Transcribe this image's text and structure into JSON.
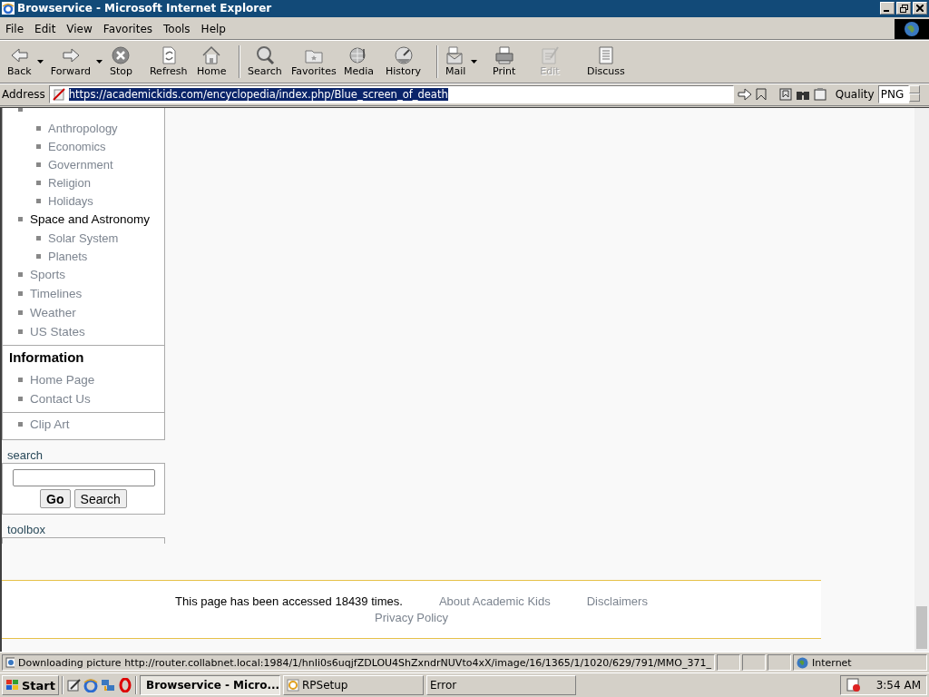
{
  "window": {
    "title": "Browservice - Microsoft Internet Explorer"
  },
  "menu": [
    "File",
    "Edit",
    "View",
    "Favorites",
    "Tools",
    "Help"
  ],
  "toolbar": [
    {
      "label": "Back",
      "kind": "back",
      "disabled": false,
      "dropdown": true
    },
    {
      "label": "Forward",
      "kind": "forward",
      "disabled": false,
      "dropdown": true
    },
    {
      "label": "Stop",
      "kind": "stop",
      "disabled": false,
      "dropdown": false
    },
    {
      "label": "Refresh",
      "kind": "refresh",
      "disabled": false,
      "dropdown": false
    },
    {
      "label": "Home",
      "kind": "home",
      "disabled": false,
      "dropdown": false
    },
    {
      "label": "Search",
      "kind": "search",
      "disabled": false,
      "dropdown": false
    },
    {
      "label": "Favorites",
      "kind": "favorites",
      "disabled": false,
      "dropdown": false
    },
    {
      "label": "Media",
      "kind": "media",
      "disabled": false,
      "dropdown": false
    },
    {
      "label": "History",
      "kind": "history",
      "disabled": false,
      "dropdown": false
    },
    {
      "label": "Mail",
      "kind": "mail",
      "disabled": false,
      "dropdown": true
    },
    {
      "label": "Print",
      "kind": "print",
      "disabled": false,
      "dropdown": false
    },
    {
      "label": "Edit",
      "kind": "edit",
      "disabled": true,
      "dropdown": false
    },
    {
      "label": "Discuss",
      "kind": "discuss",
      "disabled": false,
      "dropdown": false
    }
  ],
  "address": {
    "label": "Address",
    "value": "https://academickids.com/encyclopedia/index.php/Blue_screen_of_death",
    "quality_label": "Quality",
    "quality": "PNG"
  },
  "sidebar": {
    "nav": [
      {
        "children": [
          {
            "label": "Anthropology",
            "active": false
          },
          {
            "label": "Economics",
            "active": false
          },
          {
            "label": "Government",
            "active": false
          },
          {
            "label": "Religion",
            "active": false
          },
          {
            "label": "Holidays",
            "active": false
          }
        ]
      },
      {
        "label": "Space and Astronomy",
        "active": true,
        "children": [
          {
            "label": "Solar System",
            "active": false
          },
          {
            "label": "Planets",
            "active": false
          }
        ]
      },
      {
        "label": "Sports",
        "active": false
      },
      {
        "label": "Timelines",
        "active": false
      },
      {
        "label": "Weather",
        "active": false
      },
      {
        "label": "US States",
        "active": false
      }
    ],
    "information": {
      "heading": "Information",
      "items": [
        "Home Page",
        "Contact Us"
      ],
      "extra": [
        "Clip Art"
      ]
    },
    "search": {
      "label": "search",
      "buttons": [
        "Go",
        "Search"
      ]
    },
    "toolbox": {
      "label": "toolbox"
    }
  },
  "footer": {
    "text": "This page has been accessed 18439 times.",
    "links": [
      "About Academic Kids",
      "Disclaimers",
      "Privacy Policy"
    ]
  },
  "status_bar": {
    "text": "Downloading picture http://router.collabnet.local:1984/1/hnIi0s6uqjfZDLOU4ShZxndrNUVto4xX/image/16/1365/1/1020/629/791/MMO_371_",
    "zone": "Internet"
  },
  "taskbar": {
    "start": "Start",
    "tasks": [
      {
        "label": "Browservice - Micro...",
        "selected": true
      },
      {
        "label": "RPSetup",
        "selected": false
      },
      {
        "label": "Error",
        "selected": false
      }
    ],
    "clock": "3:54 AM"
  }
}
